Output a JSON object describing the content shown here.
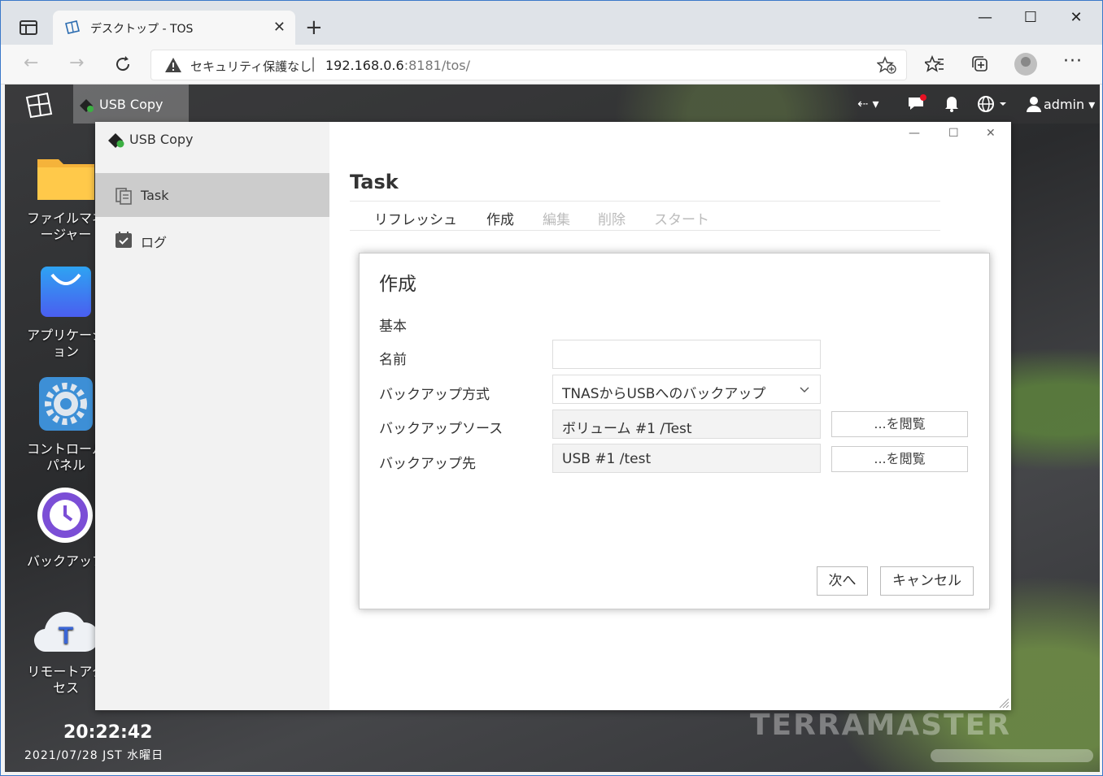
{
  "browser": {
    "tab_title": "デスクトップ - TOS",
    "security_text": "セキュリティ保護なし",
    "url_host": "192.168.0.6",
    "url_rest": ":8181/tos/",
    "separator": "|"
  },
  "taskbar": {
    "app_label": "USB Copy",
    "user": "admin"
  },
  "desktop": {
    "icons": [
      {
        "label": "ファイルマネージャー"
      },
      {
        "label": "アプリケーション"
      },
      {
        "label": "コントロールパネル"
      },
      {
        "label": "バックアップ"
      },
      {
        "label": "リモートアクセス"
      }
    ],
    "time": "20:22:42",
    "date": "2021/07/28 JST 水曜日",
    "watermark": "TERRAMASTER"
  },
  "window": {
    "title": "USB Copy",
    "nav": [
      {
        "label": "Task",
        "active": true
      },
      {
        "label": "ログ",
        "active": false
      }
    ],
    "main_title": "Task",
    "menu": [
      {
        "label": "リフレッシュ",
        "enabled": true
      },
      {
        "label": "作成",
        "enabled": true
      },
      {
        "label": "編集",
        "enabled": false
      },
      {
        "label": "削除",
        "enabled": false
      },
      {
        "label": "スタート",
        "enabled": false
      }
    ]
  },
  "dialog": {
    "title": "作成",
    "section": "基本",
    "fields": {
      "name_label": "名前",
      "name_value": "",
      "method_label": "バックアップ方式",
      "method_value": "TNASからUSBへのバックアップ",
      "source_label": "バックアップソース",
      "source_value": "ボリューム #1 /Test",
      "dest_label": "バックアップ先",
      "dest_value": "USB #1 /test",
      "browse_label": "...を閲覧"
    },
    "next_label": "次へ",
    "cancel_label": "キャンセル"
  },
  "colors": {
    "active_nav_bg": "#cccccc",
    "sidebar_bg": "#f2f2f2",
    "notification_dot": "#e81123"
  }
}
